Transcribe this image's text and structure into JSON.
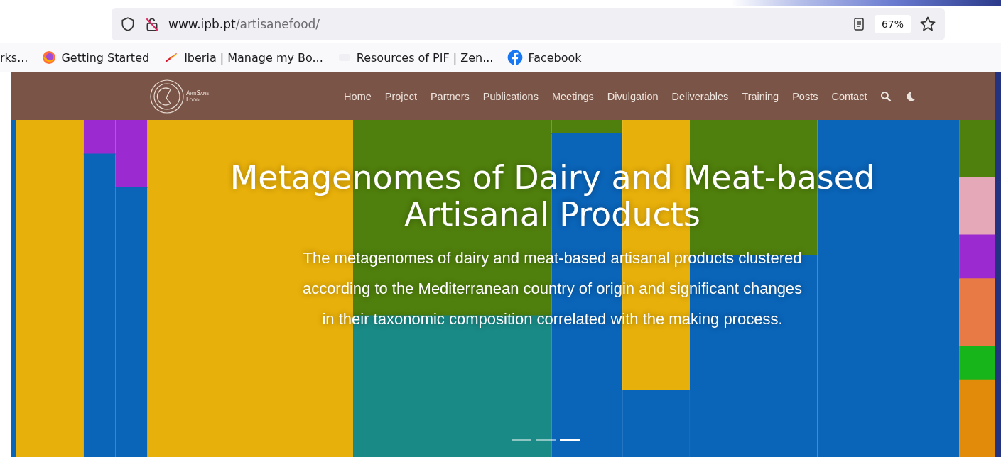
{
  "address_bar": {
    "url_host": "www.ipb.pt",
    "url_path": "/artisanefood/",
    "zoom": "67%"
  },
  "bookmarks": [
    {
      "label": "rks..."
    },
    {
      "label": "Getting Started"
    },
    {
      "label": "Iberia | Manage my Bo..."
    },
    {
      "label": "Resources of PIF | Zen..."
    },
    {
      "label": "Facebook"
    }
  ],
  "site_nav": {
    "logo_line_1": "ArtiSane",
    "logo_line_2": "Food",
    "items": [
      "Home",
      "Project",
      "Partners",
      "Publications",
      "Meetings",
      "Divulgation",
      "Deliverables",
      "Training",
      "Posts",
      "Contact"
    ]
  },
  "hero": {
    "title": "Metagenomes of Dairy and Meat-based Artisanal Products",
    "text": "The metagenomes of dairy and meat-based artisanal products clustered according to the Mediterranean country of origin and significant changes in their taxonomic composition correlated with the making process.",
    "indicators": [
      {
        "selected": false
      },
      {
        "selected": false
      },
      {
        "selected": true
      }
    ]
  }
}
